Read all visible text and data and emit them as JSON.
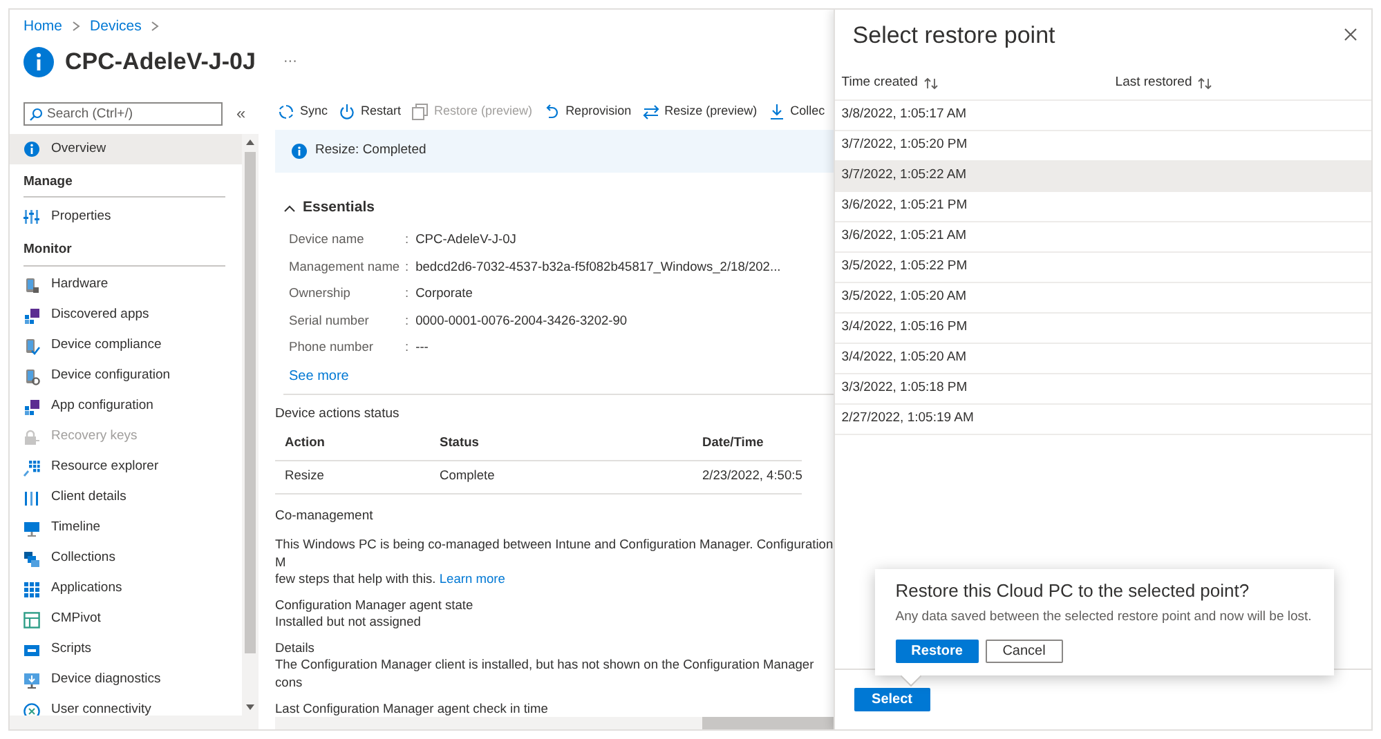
{
  "breadcrumb": [
    {
      "label": "Home"
    },
    {
      "label": "Devices"
    }
  ],
  "title": "CPC-AdeleV-J-0J",
  "more": "···",
  "sidebar": {
    "search": {
      "placeholder": "Search (Ctrl+/)"
    },
    "collapse": "«",
    "sections": [
      {
        "items": [
          {
            "label": "Overview",
            "selected": true,
            "disabled": false
          }
        ]
      },
      {
        "heading": "Manage",
        "items": [
          {
            "label": "Properties",
            "selected": false,
            "disabled": false
          }
        ]
      },
      {
        "heading": "Monitor",
        "items": [
          {
            "label": "Hardware",
            "selected": false,
            "disabled": false
          },
          {
            "label": "Discovered apps",
            "selected": false,
            "disabled": false
          },
          {
            "label": "Device compliance",
            "selected": false,
            "disabled": false
          },
          {
            "label": "Device configuration",
            "selected": false,
            "disabled": false
          },
          {
            "label": "App configuration",
            "selected": false,
            "disabled": false
          },
          {
            "label": "Recovery keys",
            "selected": false,
            "disabled": true
          },
          {
            "label": "Resource explorer",
            "selected": false,
            "disabled": false
          },
          {
            "label": "Client details",
            "selected": false,
            "disabled": false
          },
          {
            "label": "Timeline",
            "selected": false,
            "disabled": false
          },
          {
            "label": "Collections",
            "selected": false,
            "disabled": false
          },
          {
            "label": "Applications",
            "selected": false,
            "disabled": false
          },
          {
            "label": "CMPivot",
            "selected": false,
            "disabled": false
          },
          {
            "label": "Scripts",
            "selected": false,
            "disabled": false
          },
          {
            "label": "Device diagnostics",
            "selected": false,
            "disabled": false
          },
          {
            "label": "User connectivity",
            "selected": false,
            "disabled": false
          }
        ]
      }
    ]
  },
  "toolbar": [
    {
      "label": "Sync",
      "disabled": false
    },
    {
      "label": "Restart",
      "disabled": false
    },
    {
      "label": "Restore (preview)",
      "disabled": true
    },
    {
      "label": "Reprovision",
      "disabled": false
    },
    {
      "label": "Resize (preview)",
      "disabled": false
    },
    {
      "label": "Collec",
      "disabled": false
    }
  ],
  "banner": {
    "text": "Resize: Completed"
  },
  "essentials": {
    "heading": "Essentials",
    "expanded": true,
    "separator": ":",
    "fields": [
      {
        "label": "Device name",
        "value": "CPC-AdeleV-J-0J"
      },
      {
        "label": "Management name",
        "value": "bedcd2d6-7032-4537-b32a-f5f082b45817_Windows_2/18/202..."
      },
      {
        "label": "Ownership",
        "value": "Corporate"
      },
      {
        "label": "Serial number",
        "value": "0000-0001-0076-2004-3426-3202-90"
      },
      {
        "label": "Phone number",
        "value": "---"
      }
    ],
    "see_more": "See more"
  },
  "actions_status": {
    "title": "Device actions status",
    "columns": [
      "Action",
      "Status",
      "Date/Time"
    ],
    "rows": [
      [
        "Resize",
        "Complete",
        "2/23/2022, 4:50:5"
      ]
    ]
  },
  "co_management": {
    "title": "Co-management",
    "lines": [
      "This Windows PC is being co-managed between Intune and Configuration Manager. Configuration M",
      "few steps that help with this."
    ],
    "link": "Learn more",
    "fields": [
      {
        "label": "Configuration Manager agent state",
        "value": "Installed but not assigned"
      },
      {
        "label": "Details",
        "value": "The Configuration Manager client is installed, but has not shown on the Configuration Manager cons"
      },
      {
        "label": "Last Configuration Manager agent check in time"
      }
    ]
  },
  "restore_panel": {
    "title": "Select restore point",
    "columns": [
      "Time created",
      "Last restored"
    ],
    "rows": [
      {
        "time": "3/8/2022, 1:05:17 AM",
        "selected": false
      },
      {
        "time": "3/7/2022, 1:05:20 PM",
        "selected": false
      },
      {
        "time": "3/7/2022, 1:05:22 AM",
        "selected": true
      },
      {
        "time": "3/6/2022, 1:05:21 PM",
        "selected": false
      },
      {
        "time": "3/6/2022, 1:05:21 AM",
        "selected": false
      },
      {
        "time": "3/5/2022, 1:05:22 PM",
        "selected": false
      },
      {
        "time": "3/5/2022, 1:05:20 AM",
        "selected": false
      },
      {
        "time": "3/4/2022, 1:05:16 PM",
        "selected": false
      },
      {
        "time": "3/4/2022, 1:05:20 AM",
        "selected": false
      },
      {
        "time": "3/3/2022, 1:05:18 PM",
        "selected": false
      },
      {
        "time": "2/27/2022, 1:05:19 AM",
        "selected": false
      }
    ],
    "select_button": "Select"
  },
  "confirm": {
    "title": "Restore this Cloud PC to the selected point?",
    "text": "Any data saved between the selected restore point and now will be lost.",
    "buttons": [
      {
        "label": "Restore",
        "kind": "primary"
      },
      {
        "label": "Cancel",
        "kind": "secondary"
      }
    ]
  }
}
